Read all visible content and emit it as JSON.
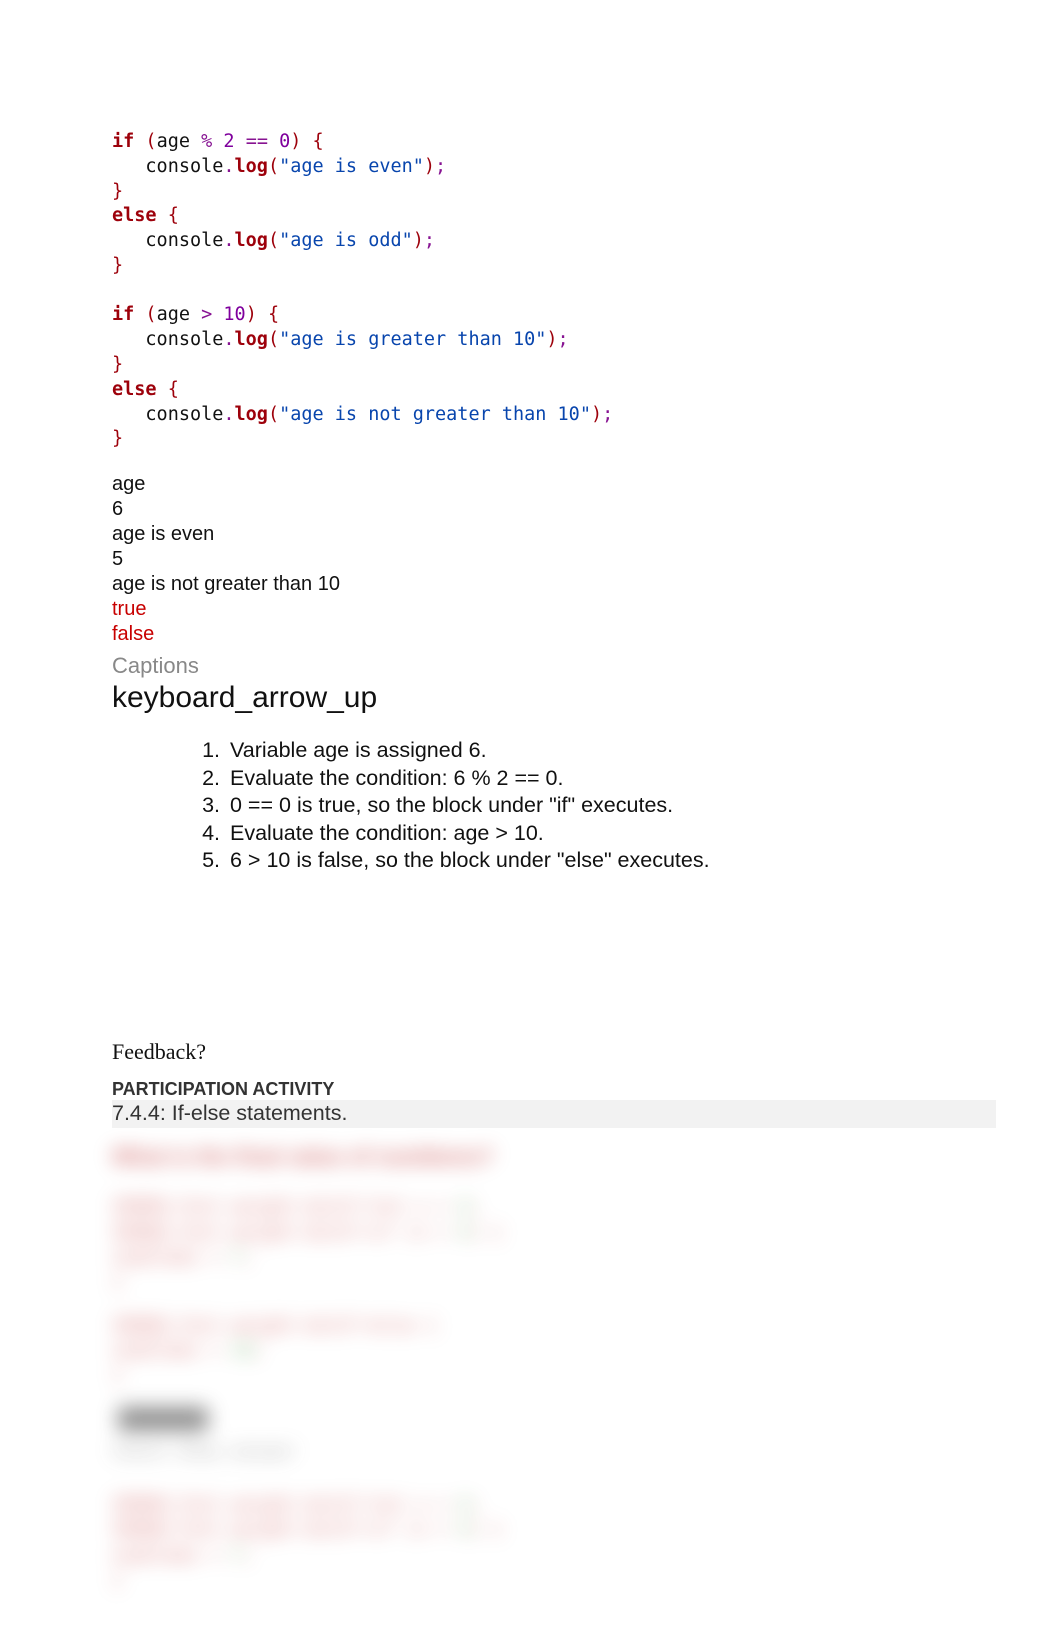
{
  "code": {
    "tokens": [
      [
        {
          "t": "if",
          "c": "kw"
        },
        {
          "t": " ",
          "c": ""
        },
        {
          "t": "(",
          "c": "paren"
        },
        {
          "t": "age ",
          "c": ""
        },
        {
          "t": "%",
          "c": "op"
        },
        {
          "t": " ",
          "c": ""
        },
        {
          "t": "2",
          "c": "num"
        },
        {
          "t": " ",
          "c": ""
        },
        {
          "t": "==",
          "c": "op"
        },
        {
          "t": " ",
          "c": ""
        },
        {
          "t": "0",
          "c": "num"
        },
        {
          "t": ")",
          "c": "paren"
        },
        {
          "t": " ",
          "c": ""
        },
        {
          "t": "{",
          "c": "brace"
        }
      ],
      [
        {
          "t": "   console",
          "c": ""
        },
        {
          "t": ".",
          "c": "punct"
        },
        {
          "t": "log",
          "c": "method"
        },
        {
          "t": "(",
          "c": "paren"
        },
        {
          "t": "\"age is even\"",
          "c": "str"
        },
        {
          "t": ")",
          "c": "paren"
        },
        {
          "t": ";",
          "c": "punct"
        }
      ],
      [
        {
          "t": "}",
          "c": "brace"
        }
      ],
      [
        {
          "t": "else",
          "c": "kw"
        },
        {
          "t": " ",
          "c": ""
        },
        {
          "t": "{",
          "c": "brace"
        }
      ],
      [
        {
          "t": "   console",
          "c": ""
        },
        {
          "t": ".",
          "c": "punct"
        },
        {
          "t": "log",
          "c": "method"
        },
        {
          "t": "(",
          "c": "paren"
        },
        {
          "t": "\"age is odd\"",
          "c": "str"
        },
        {
          "t": ")",
          "c": "paren"
        },
        {
          "t": ";",
          "c": "punct"
        }
      ],
      [
        {
          "t": "}",
          "c": "brace"
        }
      ],
      [],
      [
        {
          "t": "if",
          "c": "kw"
        },
        {
          "t": " ",
          "c": ""
        },
        {
          "t": "(",
          "c": "paren"
        },
        {
          "t": "age ",
          "c": ""
        },
        {
          "t": ">",
          "c": "op"
        },
        {
          "t": " ",
          "c": ""
        },
        {
          "t": "10",
          "c": "num"
        },
        {
          "t": ")",
          "c": "paren"
        },
        {
          "t": " ",
          "c": ""
        },
        {
          "t": "{",
          "c": "brace"
        }
      ],
      [
        {
          "t": "   console",
          "c": ""
        },
        {
          "t": ".",
          "c": "punct"
        },
        {
          "t": "log",
          "c": "method"
        },
        {
          "t": "(",
          "c": "paren"
        },
        {
          "t": "\"age is greater than 10\"",
          "c": "str"
        },
        {
          "t": ")",
          "c": "paren"
        },
        {
          "t": ";",
          "c": "punct"
        }
      ],
      [
        {
          "t": "}",
          "c": "brace"
        }
      ],
      [
        {
          "t": "else",
          "c": "kw"
        },
        {
          "t": " ",
          "c": ""
        },
        {
          "t": "{",
          "c": "brace"
        }
      ],
      [
        {
          "t": "   console",
          "c": ""
        },
        {
          "t": ".",
          "c": "punct"
        },
        {
          "t": "log",
          "c": "method"
        },
        {
          "t": "(",
          "c": "paren"
        },
        {
          "t": "\"age is not greater than 10\"",
          "c": "str"
        },
        {
          "t": ")",
          "c": "paren"
        },
        {
          "t": ";",
          "c": "punct"
        }
      ],
      [
        {
          "t": "}",
          "c": "brace"
        }
      ]
    ]
  },
  "console_output": [
    {
      "text": "age",
      "red": false
    },
    {
      "text": "6",
      "red": false
    },
    {
      "text": "age is even",
      "red": false
    },
    {
      "text": "5",
      "red": false
    },
    {
      "text": "age is not greater than 10",
      "red": false
    },
    {
      "text": "true",
      "red": true
    },
    {
      "text": "false",
      "red": true
    }
  ],
  "captions_label": "Captions",
  "keyboard_arrow": "keyboard_arrow_up",
  "captions": [
    "Variable age is assigned 6.",
    "Evaluate the condition: 6 % 2 == 0.",
    "0 == 0 is true, so the block under \"if\" executes.",
    "Evaluate the condition: age > 10.",
    "6 > 10 is false, so the block under \"else\" executes."
  ],
  "feedback": "Feedback?",
  "activity": {
    "header": "PARTICIPATION ACTIVITY",
    "title": "7.4.4: If-else statements."
  },
  "blurred": {
    "question": "What is the final value of numItems?",
    "snippet1": [
      "let x = 4;",
      "if (x > 5) {",
      "   numItems = 7;",
      "}"
    ],
    "snippet2": [
      "else {",
      "   numItems = 10;",
      "}"
    ],
    "check": "Check   Show answer",
    "snippet3": [
      "let x = 4;",
      "if (x > 5) {",
      "   numItems = 7;",
      "}"
    ]
  }
}
